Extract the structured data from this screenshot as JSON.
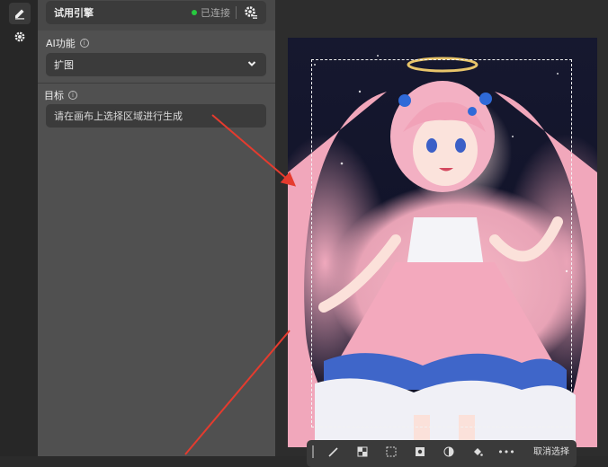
{
  "rail": {
    "icons": [
      "edit-icon",
      "gear-icon"
    ]
  },
  "engine": {
    "label": "试用引擎",
    "status": "已连接"
  },
  "ai": {
    "title": "AI功能",
    "selected": "扩图"
  },
  "target": {
    "title": "目标",
    "placeholder": "请在画布上选择区域进行生成"
  },
  "toolbar": {
    "tools": [
      "brush-icon",
      "checker-icon",
      "select-icon",
      "image-icon",
      "contrast-icon",
      "fill-icon"
    ],
    "more": "•••",
    "cancel": "取消选择"
  },
  "colors": {
    "status_dot": "#27c93f",
    "arrow": "#e53b2e"
  }
}
